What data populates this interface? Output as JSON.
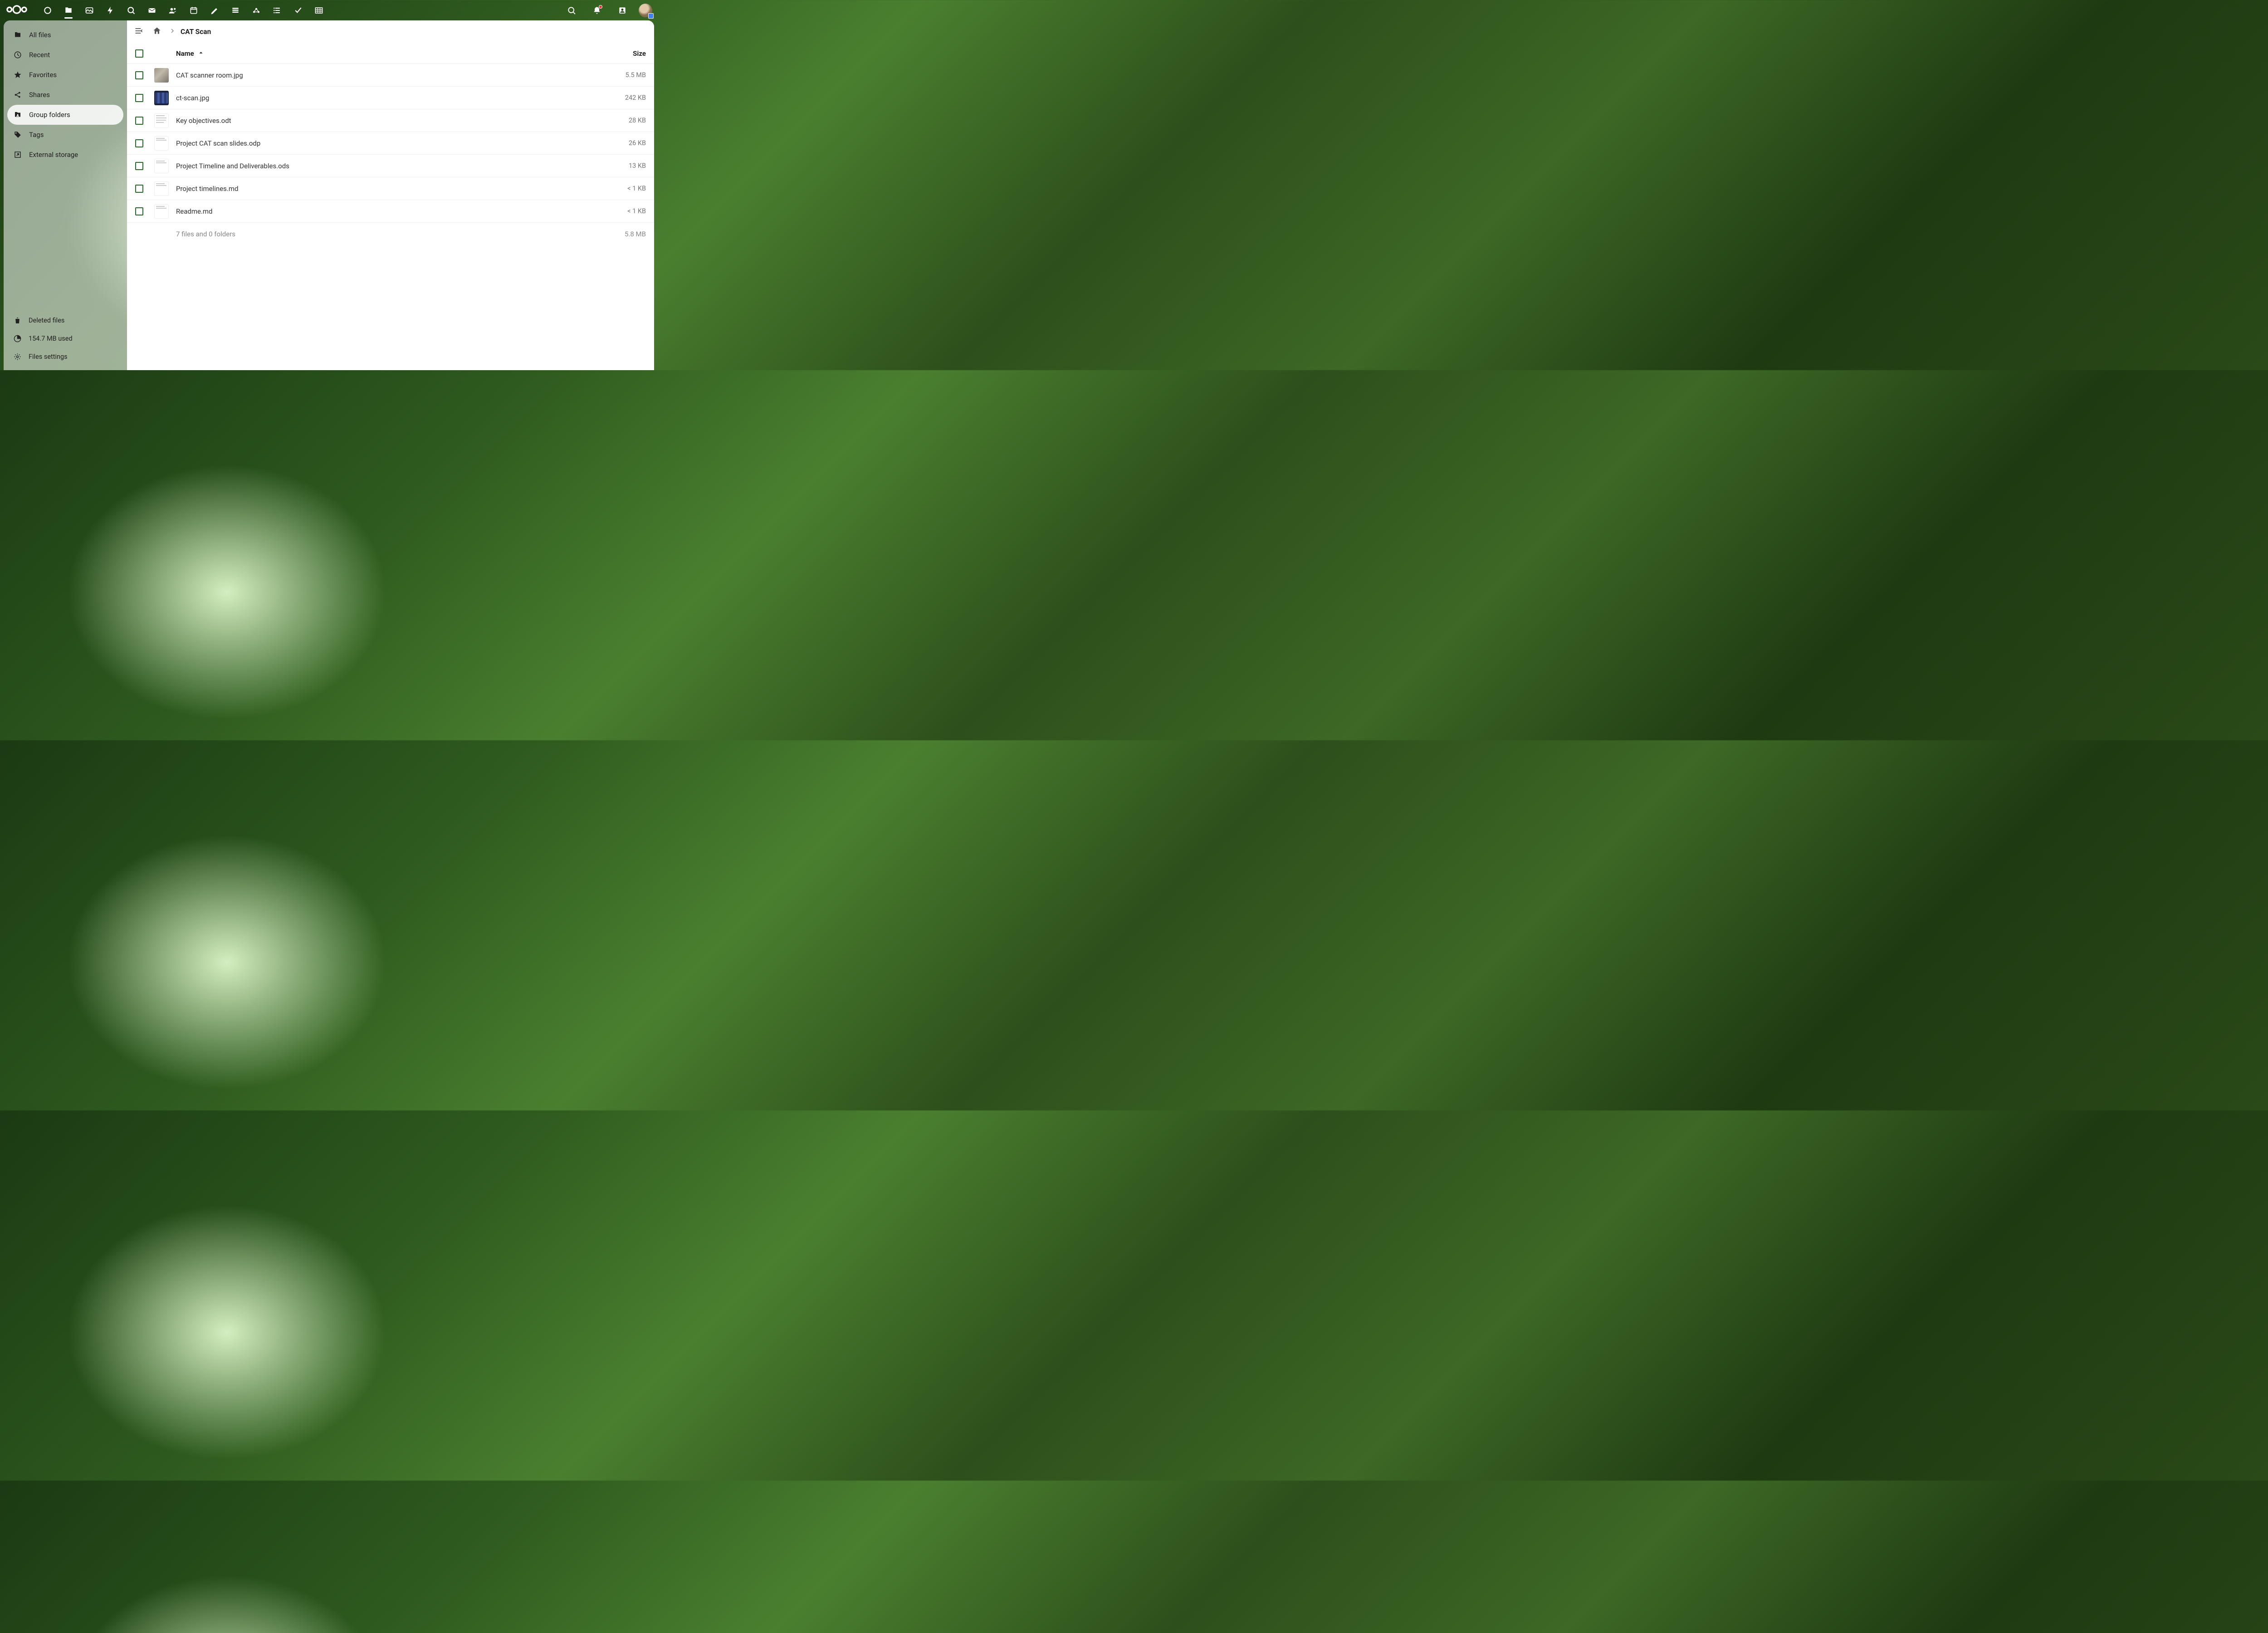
{
  "sidebar": {
    "items": [
      {
        "label": "All files"
      },
      {
        "label": "Recent"
      },
      {
        "label": "Favorites"
      },
      {
        "label": "Shares"
      },
      {
        "label": "Group folders"
      },
      {
        "label": "Tags"
      },
      {
        "label": "External storage"
      }
    ],
    "bottom": {
      "deleted": "Deleted files",
      "quota": "154.7 MB used",
      "settings": "Files settings"
    }
  },
  "breadcrumb": {
    "current": "CAT Scan"
  },
  "columns": {
    "name": "Name",
    "size": "Size"
  },
  "files": [
    {
      "name": "CAT scanner room.jpg",
      "size": "5.5 MB",
      "thumb": "img1"
    },
    {
      "name": "ct-scan.jpg",
      "size": "242 KB",
      "thumb": "img2"
    },
    {
      "name": "Key objectives.odt",
      "size": "28 KB",
      "thumb": "doc"
    },
    {
      "name": "Project CAT scan slides.odp",
      "size": "26 KB",
      "thumb": "doc doc-top"
    },
    {
      "name": "Project Timeline and Deliverables.ods",
      "size": "13 KB",
      "thumb": "doc doc-top"
    },
    {
      "name": "Project timelines.md",
      "size": "< 1 KB",
      "thumb": "doc doc-top"
    },
    {
      "name": "Readme.md",
      "size": "< 1 KB",
      "thumb": "doc doc-top"
    }
  ],
  "summary": {
    "text": "7 files and 0 folders",
    "size": "5.8 MB"
  }
}
